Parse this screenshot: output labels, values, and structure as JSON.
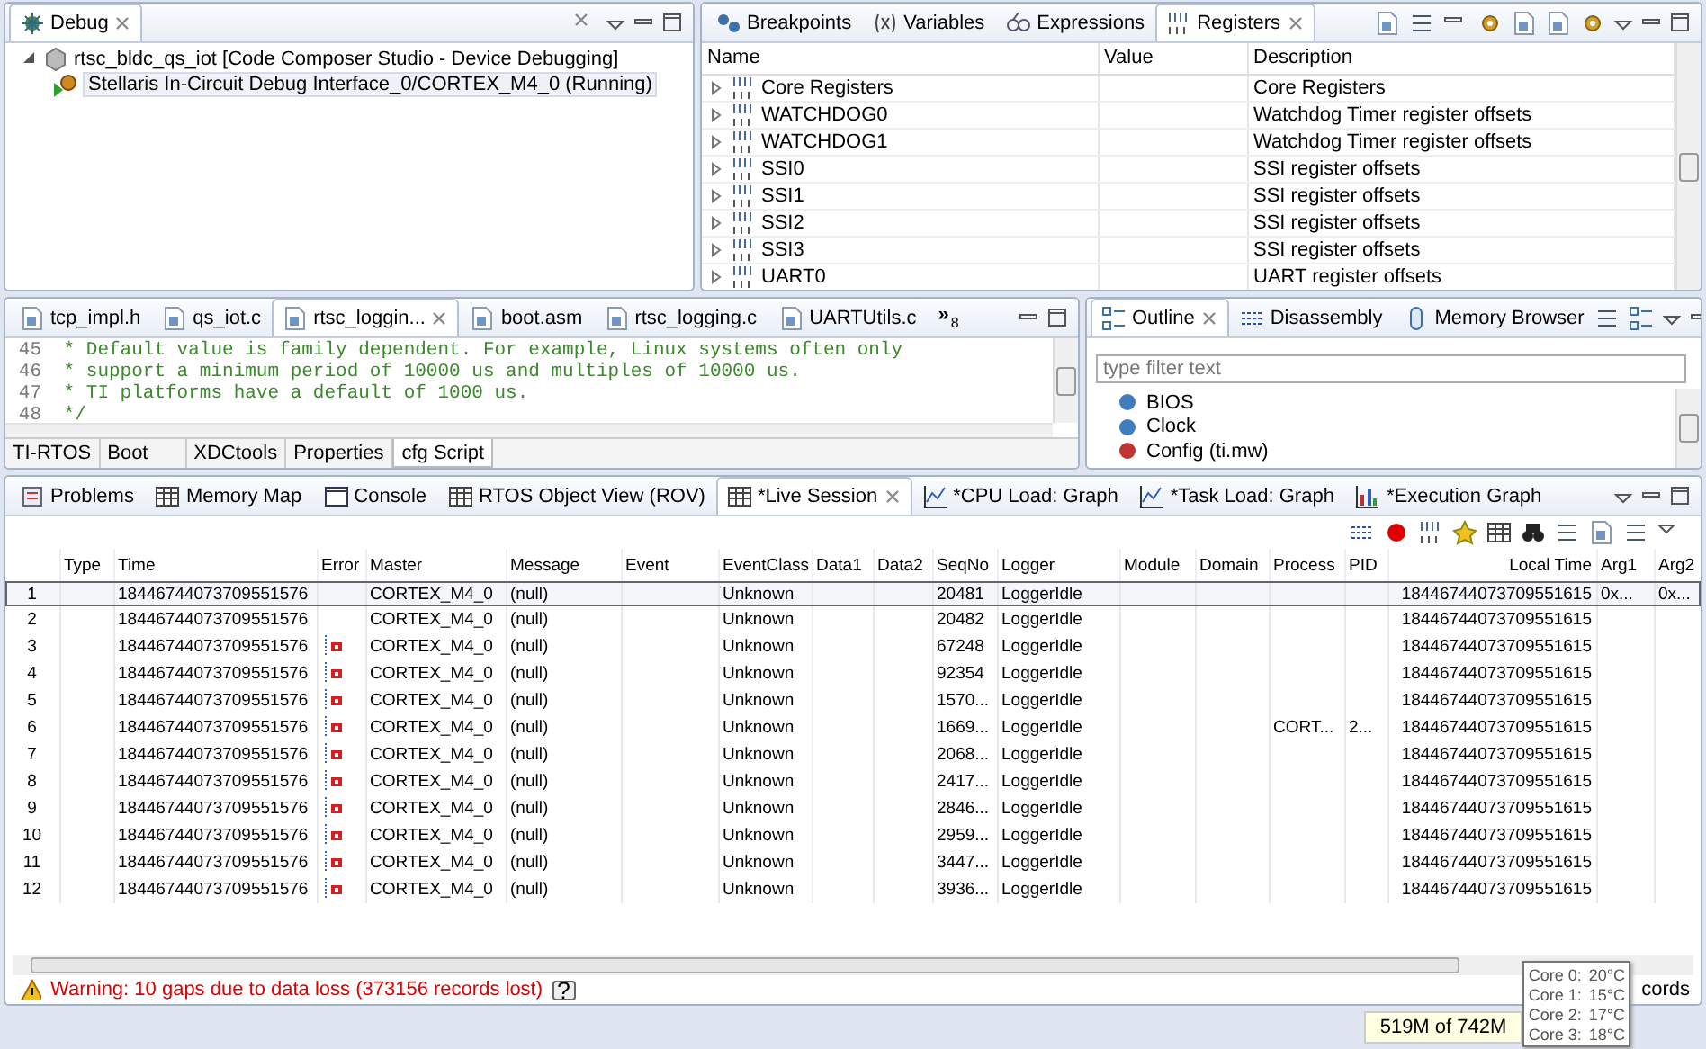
{
  "debug_view": {
    "tabs": [
      {
        "label": "Debug",
        "selected": true
      }
    ],
    "tree": [
      {
        "label": "rtsc_bldc_qs_iot [Code Composer Studio - Device Debugging]",
        "expanded": true,
        "selected": false,
        "children": [
          {
            "label": "Stellaris In-Circuit Debug Interface_0/CORTEX_M4_0 (Running)",
            "selected": true
          }
        ]
      }
    ]
  },
  "registers_view": {
    "tabs": [
      {
        "label": "Breakpoints",
        "selected": false
      },
      {
        "label": "Variables",
        "selected": false
      },
      {
        "label": "Expressions",
        "selected": false
      },
      {
        "label": "Registers",
        "selected": true
      }
    ],
    "columns": [
      "Name",
      "Value",
      "Description"
    ],
    "rows": [
      {
        "name": "Core Registers",
        "description": "Core Registers",
        "expanded": false
      },
      {
        "name": "WATCHDOG0",
        "description": "Watchdog Timer register offsets",
        "expanded": false
      },
      {
        "name": "WATCHDOG1",
        "description": "Watchdog Timer register offsets",
        "expanded": false
      },
      {
        "name": "SSI0",
        "description": "SSI register offsets",
        "expanded": false
      },
      {
        "name": "SSI1",
        "description": "SSI register offsets",
        "expanded": false
      },
      {
        "name": "SSI2",
        "description": "SSI register offsets",
        "expanded": false
      },
      {
        "name": "SSI3",
        "description": "SSI register offsets",
        "expanded": false
      },
      {
        "name": "UART0",
        "description": "UART register offsets",
        "expanded": false
      }
    ]
  },
  "editor": {
    "tabs": [
      {
        "label": "tcp_impl.h",
        "selected": false
      },
      {
        "label": "qs_iot.c",
        "selected": false
      },
      {
        "label": "rtsc_loggin...",
        "selected": true
      },
      {
        "label": "boot.asm",
        "selected": false
      },
      {
        "label": "rtsc_logging.c",
        "selected": false
      },
      {
        "label": "UARTUtils.c",
        "selected": false
      }
    ],
    "overflow": "»",
    "overflow_count": "8",
    "lines": [
      {
        "number": "45",
        "text": " * Default value is family dependent. For example, Linux systems often only"
      },
      {
        "number": "46",
        "text": " * support a minimum period of 10000 us and multiples of 10000 us."
      },
      {
        "number": "47",
        "text": " * TI platforms have a default of 1000 us."
      },
      {
        "number": "48",
        "text": " */"
      }
    ],
    "bottom_tabs": [
      {
        "label": "TI-RTOS",
        "selected": false
      },
      {
        "label": "Boot",
        "selected": false
      },
      {
        "label": "XDCtools",
        "selected": false
      },
      {
        "label": "Properties",
        "selected": false
      },
      {
        "label": "cfg Script",
        "selected": true
      }
    ]
  },
  "outline_view": {
    "tabs": [
      {
        "label": "Outline",
        "selected": true
      },
      {
        "label": "Disassembly",
        "selected": false
      },
      {
        "label": "Memory Browser",
        "selected": false
      }
    ],
    "filter": {
      "placeholder": "type filter text"
    },
    "items": [
      {
        "label": "BIOS",
        "color": "#3f7dbf"
      },
      {
        "label": "Clock",
        "color": "#3f7dbf"
      },
      {
        "label": "Config (ti.mw)",
        "color": "#c03434"
      }
    ]
  },
  "live_session": {
    "tabs": [
      {
        "label": "Problems",
        "selected": false
      },
      {
        "label": "Memory Map",
        "selected": false
      },
      {
        "label": "Console",
        "selected": false
      },
      {
        "label": "RTOS Object View (ROV)",
        "selected": false
      },
      {
        "label": "*Live Session",
        "selected": true
      },
      {
        "label": "*CPU Load: Graph",
        "selected": false
      },
      {
        "label": "*Task Load: Graph",
        "selected": false
      },
      {
        "label": "*Execution Graph",
        "selected": false
      }
    ],
    "columns": [
      "Type",
      "Time",
      "Error",
      "Master",
      "Message",
      "Event",
      "EventClass",
      "Data1",
      "Data2",
      "SeqNo",
      "Logger",
      "Module",
      "Domain",
      "Process",
      "PID",
      "Local Time",
      "Arg1",
      "Arg2"
    ],
    "rows": [
      {
        "number": "1",
        "time": "18446744073709551576",
        "error": false,
        "master": "CORTEX_M4_0",
        "message": "(null)",
        "event_class": "Unknown",
        "seq_no": "20481",
        "logger": "LoggerIdle",
        "local_time": "18446744073709551615",
        "arg1": "0x...",
        "arg2": "0x...",
        "selected": true
      },
      {
        "number": "2",
        "time": "18446744073709551576",
        "error": false,
        "master": "CORTEX_M4_0",
        "message": "(null)",
        "event_class": "Unknown",
        "seq_no": "20482",
        "logger": "LoggerIdle",
        "local_time": "18446744073709551615",
        "selected": false
      },
      {
        "number": "3",
        "time": "18446744073709551576",
        "error": true,
        "master": "CORTEX_M4_0",
        "message": "(null)",
        "event_class": "Unknown",
        "seq_no": "67248",
        "logger": "LoggerIdle",
        "local_time": "18446744073709551615",
        "selected": false
      },
      {
        "number": "4",
        "time": "18446744073709551576",
        "error": true,
        "master": "CORTEX_M4_0",
        "message": "(null)",
        "event_class": "Unknown",
        "seq_no": "92354",
        "logger": "LoggerIdle",
        "local_time": "18446744073709551615",
        "selected": false
      },
      {
        "number": "5",
        "time": "18446744073709551576",
        "error": true,
        "master": "CORTEX_M4_0",
        "message": "(null)",
        "event_class": "Unknown",
        "seq_no": "1570...",
        "logger": "LoggerIdle",
        "local_time": "18446744073709551615",
        "selected": false
      },
      {
        "number": "6",
        "time": "18446744073709551576",
        "error": true,
        "master": "CORTEX_M4_0",
        "message": "(null)",
        "event_class": "Unknown",
        "seq_no": "1669...",
        "logger": "LoggerIdle",
        "process": "CORT...",
        "pid": "2...",
        "local_time": "18446744073709551615",
        "selected": false
      },
      {
        "number": "7",
        "time": "18446744073709551576",
        "error": true,
        "master": "CORTEX_M4_0",
        "message": "(null)",
        "event_class": "Unknown",
        "seq_no": "2068...",
        "logger": "LoggerIdle",
        "local_time": "18446744073709551615",
        "selected": false
      },
      {
        "number": "8",
        "time": "18446744073709551576",
        "error": true,
        "master": "CORTEX_M4_0",
        "message": "(null)",
        "event_class": "Unknown",
        "seq_no": "2417...",
        "logger": "LoggerIdle",
        "local_time": "18446744073709551615",
        "selected": false
      },
      {
        "number": "9",
        "time": "18446744073709551576",
        "error": true,
        "master": "CORTEX_M4_0",
        "message": "(null)",
        "event_class": "Unknown",
        "seq_no": "2846...",
        "logger": "LoggerIdle",
        "local_time": "18446744073709551615",
        "selected": false
      },
      {
        "number": "10",
        "time": "18446744073709551576",
        "error": true,
        "master": "CORTEX_M4_0",
        "message": "(null)",
        "event_class": "Unknown",
        "seq_no": "2959...",
        "logger": "LoggerIdle",
        "local_time": "18446744073709551615",
        "selected": false
      },
      {
        "number": "11",
        "time": "18446744073709551576",
        "error": true,
        "master": "CORTEX_M4_0",
        "message": "(null)",
        "event_class": "Unknown",
        "seq_no": "3447...",
        "logger": "LoggerIdle",
        "local_time": "18446744073709551615",
        "selected": false
      },
      {
        "number": "12",
        "time": "18446744073709551576",
        "error": true,
        "master": "CORTEX_M4_0",
        "message": "(null)",
        "event_class": "Unknown",
        "seq_no": "3936...",
        "logger": "LoggerIdle",
        "local_time": "18446744073709551615",
        "selected": false
      }
    ],
    "warning": "Warning: 10 gaps due to data loss (373156 records lost)",
    "help_label": "?",
    "records_fragment": "cords"
  },
  "status_bar": {
    "memory": "519M of 742M"
  },
  "tooltip": {
    "lines": [
      {
        "label": "Core 0:",
        "value": "20°C"
      },
      {
        "label": "Core 1:",
        "value": "15°C"
      },
      {
        "label": "Core 2:",
        "value": "17°C"
      },
      {
        "label": "Core 3:",
        "value": "18°C"
      }
    ]
  }
}
